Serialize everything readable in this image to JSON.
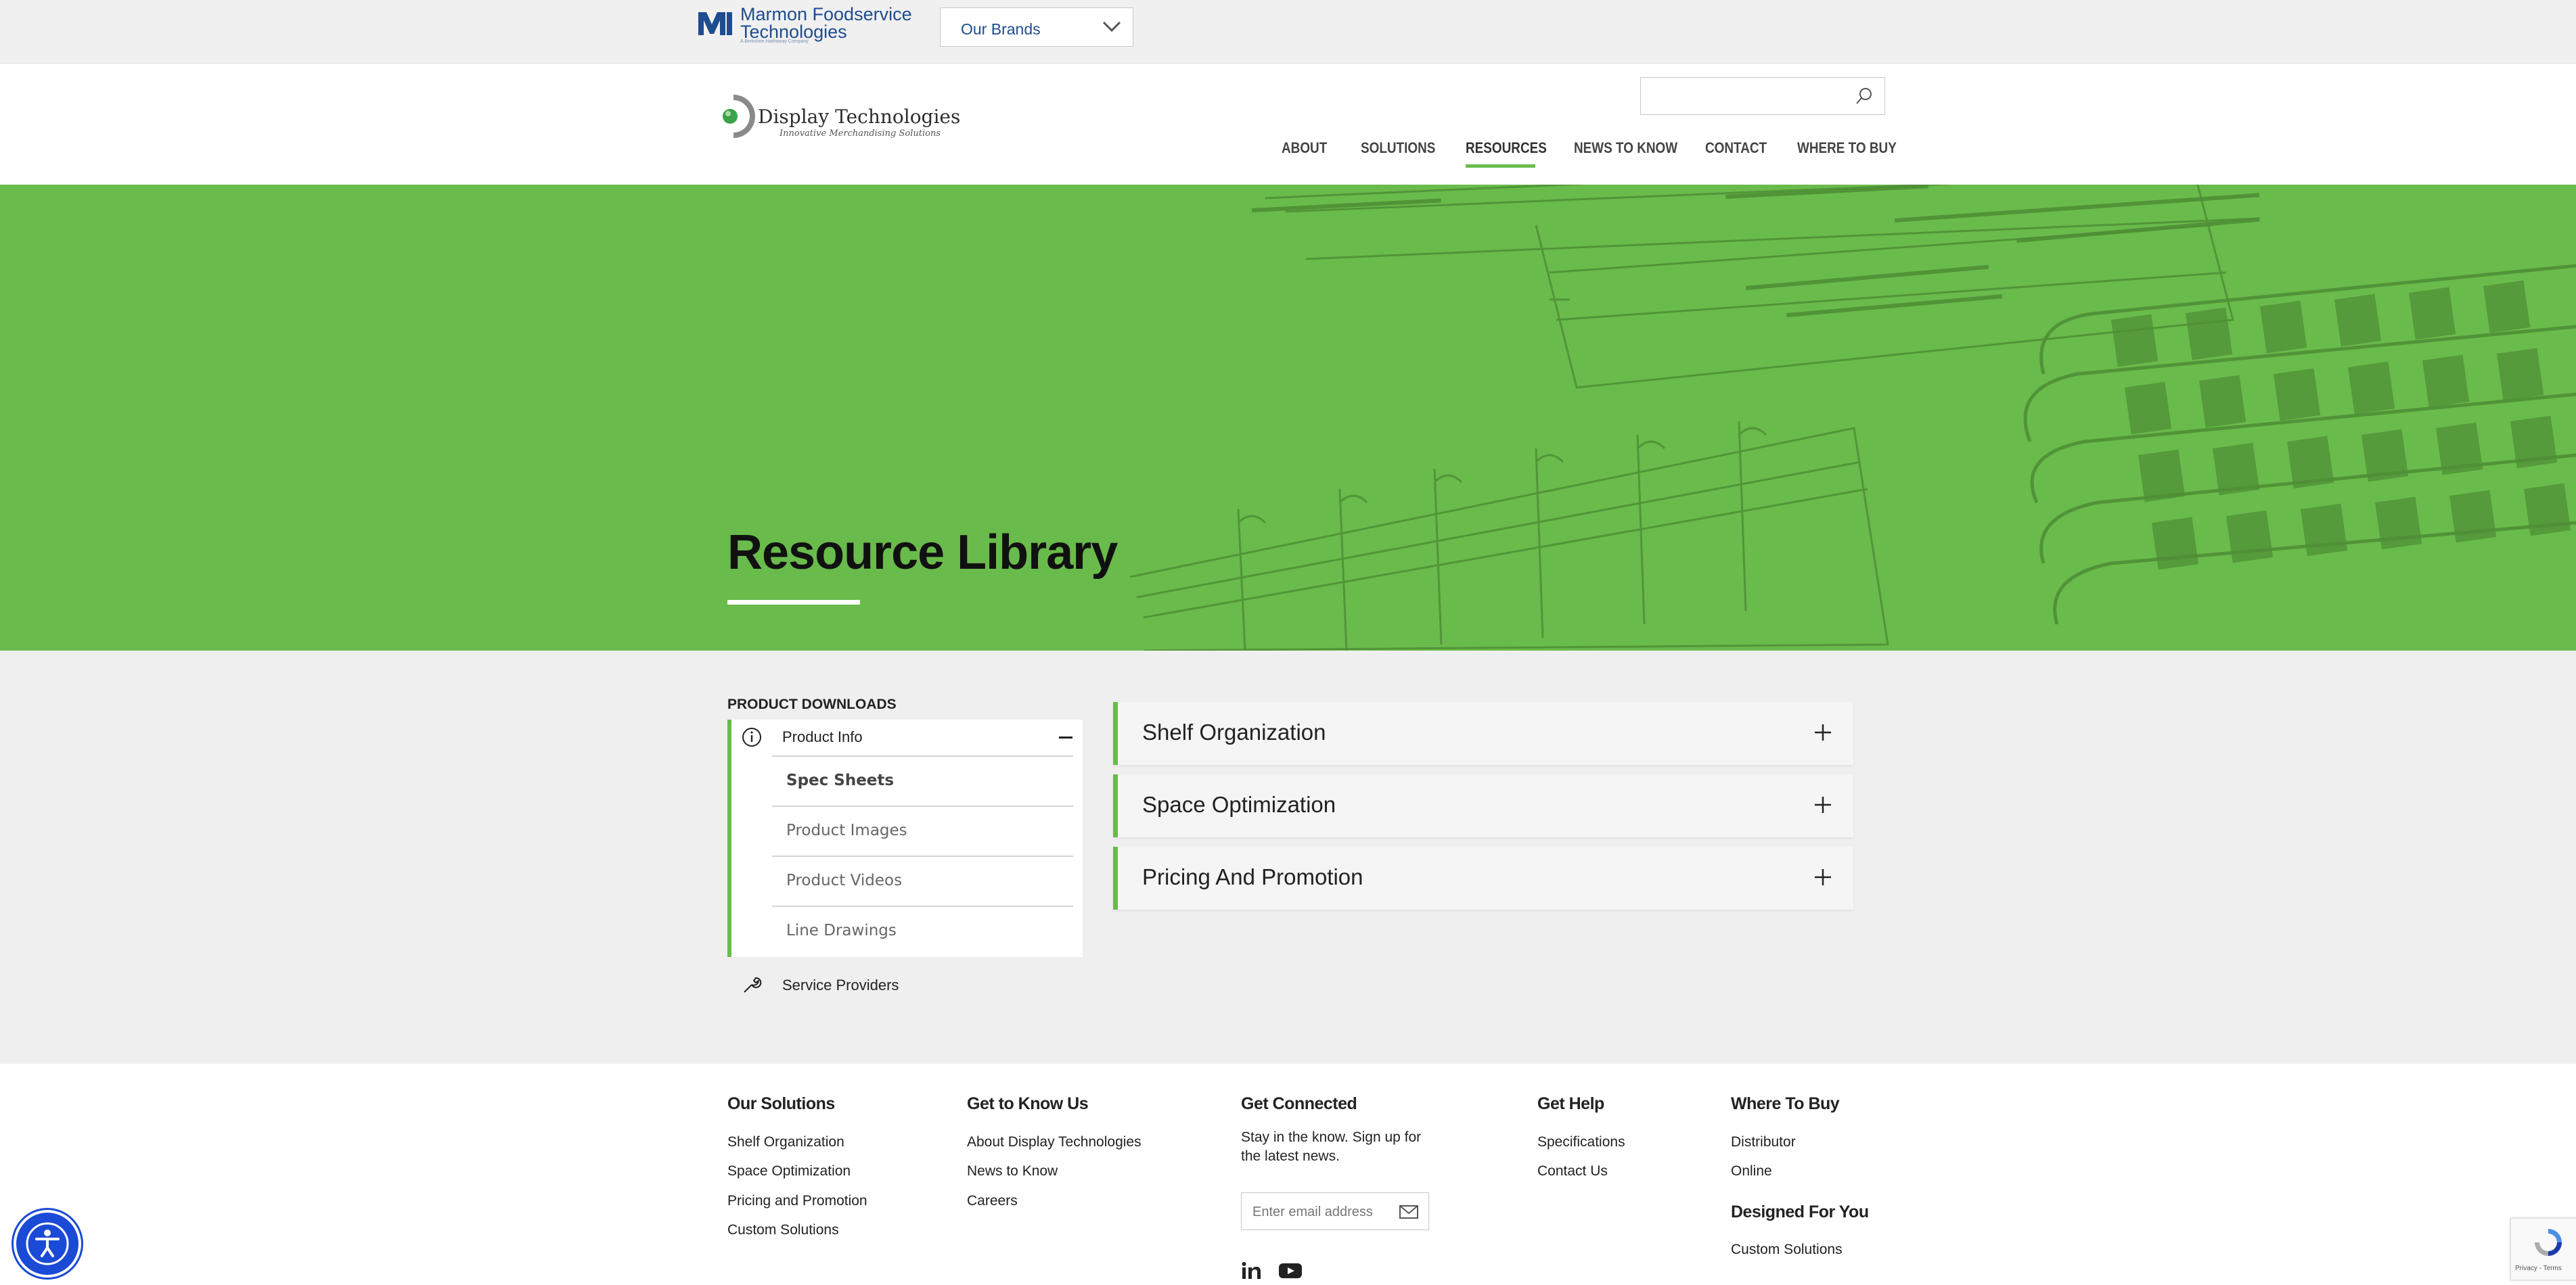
{
  "topbar": {
    "parent_brand": "Marmon Foodservice Technologies",
    "parent_brand_line1": "Marmon Foodservice",
    "parent_brand_line2": "Technologies",
    "parent_brand_tagline": "A Berkshire Hathaway Company",
    "brands_dropdown": "Our Brands"
  },
  "header": {
    "logo_name": "Display Technologies",
    "logo_tagline": "Innovative Merchandising Solutions",
    "search_placeholder": "",
    "nav": [
      "ABOUT",
      "SOLUTIONS",
      "RESOURCES",
      "NEWS TO KNOW",
      "CONTACT",
      "WHERE TO BUY"
    ],
    "active_nav": "RESOURCES"
  },
  "hero": {
    "title": "Resource Library"
  },
  "sidebar": {
    "section_label": "PRODUCT DOWNLOADS",
    "product_info": {
      "label": "Product Info",
      "items": [
        "Spec Sheets",
        "Product Images",
        "Product Videos",
        "Line Drawings"
      ],
      "selected": "Spec Sheets"
    },
    "service_providers": "Service Providers"
  },
  "accordions": [
    "Shelf Organization",
    "Space Optimization",
    "Pricing And Promotion"
  ],
  "footer": {
    "solutions": {
      "heading": "Our Solutions",
      "links": [
        "Shelf Organization",
        "Space Optimization",
        "Pricing and Promotion",
        "Custom Solutions"
      ]
    },
    "about": {
      "heading": "Get to Know Us",
      "links": [
        "About Display Technologies",
        "News to Know",
        "Careers"
      ]
    },
    "connect": {
      "heading": "Get Connected",
      "text_line1": "Stay in the know. Sign up for",
      "text_line2": "the latest news.",
      "email_placeholder": "Enter email address"
    },
    "help": {
      "heading": "Get Help",
      "links": [
        "Specifications",
        "Contact Us"
      ]
    },
    "buy": {
      "heading": "Where To Buy",
      "links": [
        "Distributor",
        "Online"
      ]
    },
    "designed": {
      "heading": "Designed For You",
      "links": [
        "Custom Solutions"
      ]
    }
  },
  "recaptcha": {
    "text": "Privacy - Terms"
  },
  "colors": {
    "accent_green": "#69bb4b",
    "brand_blue": "#1e4c8f",
    "a11y_blue": "#1a4ad6"
  },
  "icons": [
    "marmon-logo-icon",
    "chevron-down-icon",
    "display-technologies-logo-icon",
    "search-icon",
    "info-circle-icon",
    "minus-icon",
    "wrench-icon",
    "plus-icon",
    "mail-icon",
    "linkedin-icon",
    "youtube-icon",
    "accessibility-icon",
    "recaptcha-icon"
  ]
}
